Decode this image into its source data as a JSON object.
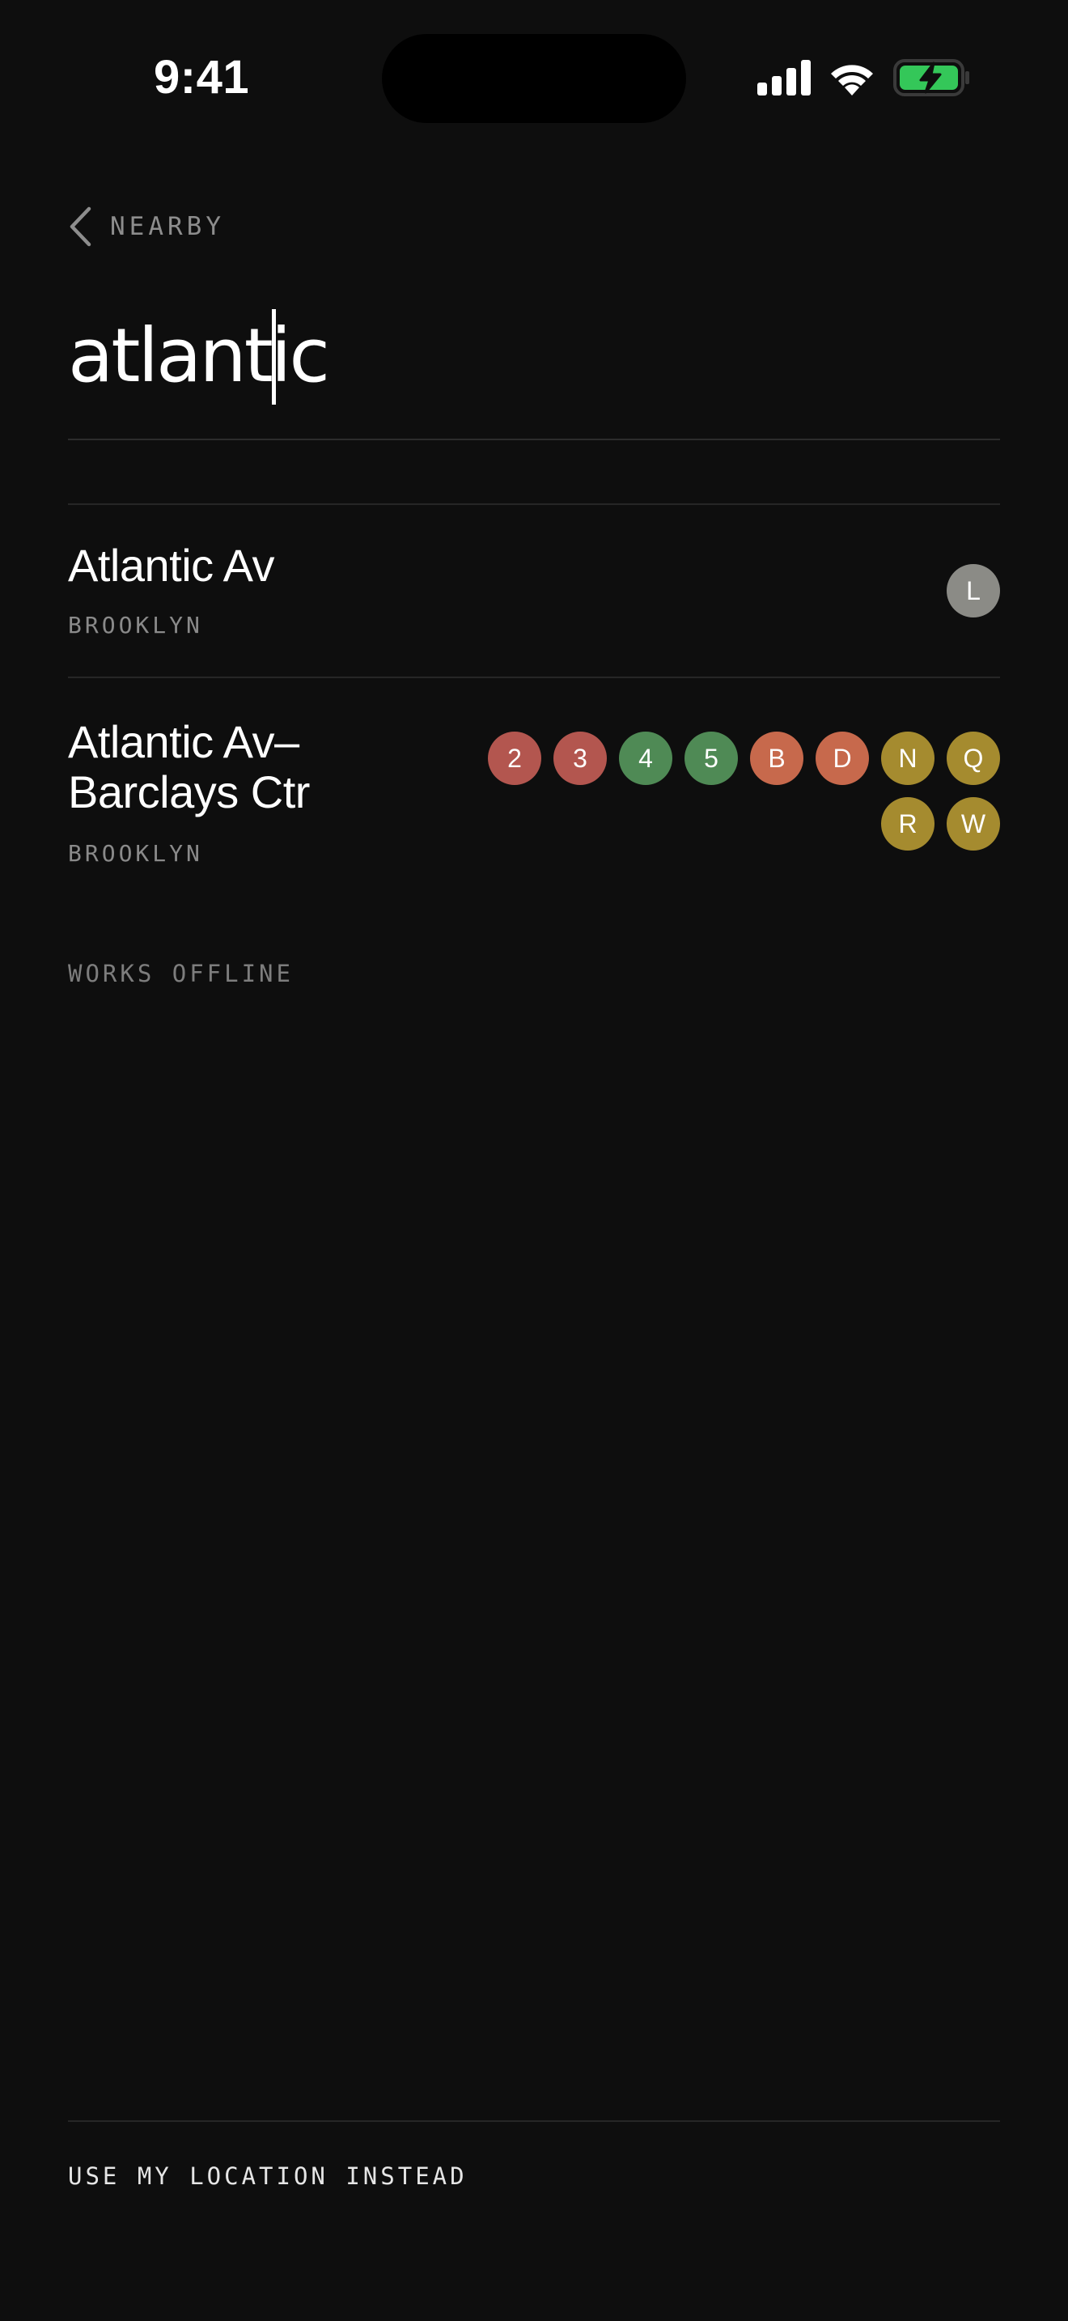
{
  "status_bar": {
    "time": "9:41"
  },
  "nav": {
    "back_label": "NEARBY"
  },
  "search": {
    "value": "atlantic"
  },
  "results": [
    {
      "name": "Atlantic Av",
      "borough": "BROOKLYN",
      "lines": [
        {
          "label": "L",
          "color": "#8b8b86"
        }
      ]
    },
    {
      "name": "Atlantic Av–\nBarclays Ctr",
      "name_line1": "Atlantic Av–",
      "name_line2": "Barclays Ctr",
      "borough": "BROOKLYN",
      "lines": [
        {
          "label": "2",
          "color": "#b3564f"
        },
        {
          "label": "3",
          "color": "#b3564f"
        },
        {
          "label": "4",
          "color": "#4f8a55"
        },
        {
          "label": "5",
          "color": "#4f8a55"
        },
        {
          "label": "B",
          "color": "#c7694c"
        },
        {
          "label": "D",
          "color": "#c7694c"
        },
        {
          "label": "N",
          "color": "#a58b2f"
        },
        {
          "label": "Q",
          "color": "#a58b2f"
        },
        {
          "label": "R",
          "color": "#a58b2f"
        },
        {
          "label": "W",
          "color": "#a58b2f"
        }
      ]
    }
  ],
  "offline_note": "WORKS OFFLINE",
  "footer": {
    "location_link": "USE MY LOCATION INSTEAD"
  },
  "colors": {
    "background": "#0e0e0e",
    "battery_fill": "#34c759"
  }
}
